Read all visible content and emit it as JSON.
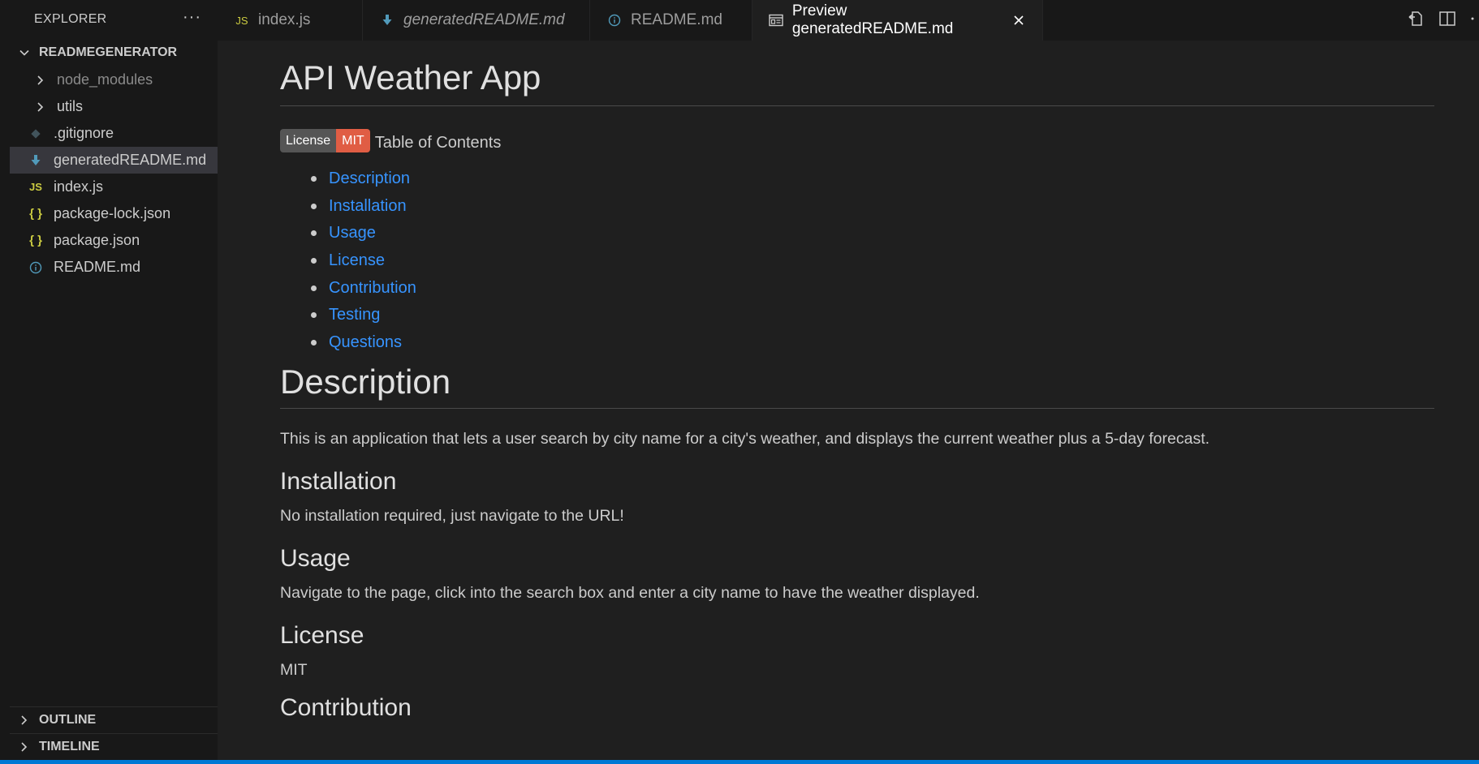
{
  "sidebar": {
    "title": "EXPLORER",
    "more": "···",
    "project": "READMEGENERATOR",
    "items": [
      {
        "label": "node_modules",
        "type": "folder"
      },
      {
        "label": "utils",
        "type": "folder"
      },
      {
        "label": ".gitignore",
        "type": "gitignore"
      },
      {
        "label": "generatedREADME.md",
        "type": "markdown"
      },
      {
        "label": "index.js",
        "type": "js"
      },
      {
        "label": "package-lock.json",
        "type": "json"
      },
      {
        "label": "package.json",
        "type": "json"
      },
      {
        "label": "README.md",
        "type": "info"
      }
    ],
    "outline": "OUTLINE",
    "timeline": "TIMELINE"
  },
  "tabs": [
    {
      "label": "index.js",
      "icon": "js-icon"
    },
    {
      "label": "generatedREADME.md",
      "icon": "markdown-icon"
    },
    {
      "label": "README.md",
      "icon": "info-icon"
    },
    {
      "label": "Preview generatedREADME.md",
      "icon": "preview-icon"
    }
  ],
  "icons": {
    "js": "JS",
    "json": "{ }"
  },
  "preview": {
    "title": "API Weather App",
    "badge": {
      "left": "License",
      "right": "MIT"
    },
    "toc_heading": "Table of Contents",
    "toc": [
      "Description",
      "Installation",
      "Usage",
      "License",
      "Contribution",
      "Testing",
      "Questions"
    ],
    "description_heading": "Description",
    "description": "This is an application that lets a user search by city name for a city's weather, and displays the current weather plus a 5-day forecast.",
    "installation_heading": "Installation",
    "installation": "No installation required, just navigate to the URL!",
    "usage_heading": "Usage",
    "usage": "Navigate to the page, click into the search box and enter a city name to have the weather displayed.",
    "license_heading": "License",
    "license": "MIT",
    "contribution_heading": "Contribution"
  },
  "colors": {
    "accent": "#0078d4",
    "link": "#3794ff",
    "badge_right": "#e05d44",
    "badge_left": "#555555"
  }
}
